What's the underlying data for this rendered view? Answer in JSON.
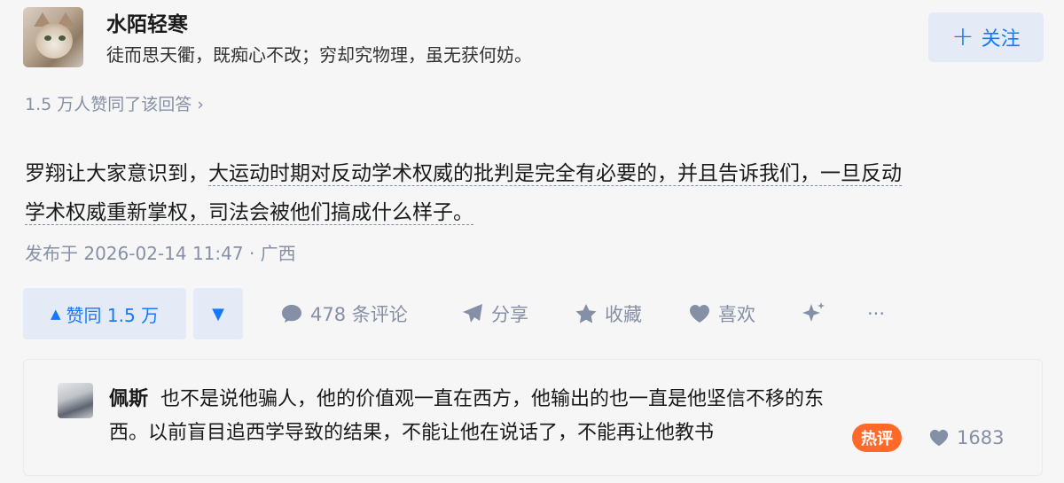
{
  "author": {
    "name": "水陌轻寒",
    "bio": "徒而思天衢，既痴心不改；穷却究物理，虽无获何妨。",
    "follow_label": "关注"
  },
  "approve_summary": "1.5 万人赞同了该回答 ›",
  "answer": {
    "text_plain": "罗翔让大家意识到，",
    "text_underlined_1": "大运动时期对反动学术权威的批判是完全有必要的，并且告诉我们，一旦反动",
    "text_underlined_2": "学术权威重新掌权，司法会被他们搞成什么样子。"
  },
  "meta": "发布于 2026-02-14 11:47 · 广西",
  "actions": {
    "vote_up_label": "赞同 1.5 万",
    "comments": "478 条评论",
    "share": "分享",
    "collect": "收藏",
    "like": "喜欢",
    "more": "···"
  },
  "hot_comment": {
    "name": "佩斯",
    "text_line1": "也不是说他骗人，他的价值观一直在西方，他输出的也一直是他坚信不移的东",
    "text_line2": "西。以前盲目追西学导致的结果，不能让他在说话了，不能再让他教书",
    "badge": "热评",
    "likes": "1683"
  },
  "colors": {
    "accent": "#1677ff",
    "muted": "#8590a6",
    "hot": "#ff6a2b"
  }
}
